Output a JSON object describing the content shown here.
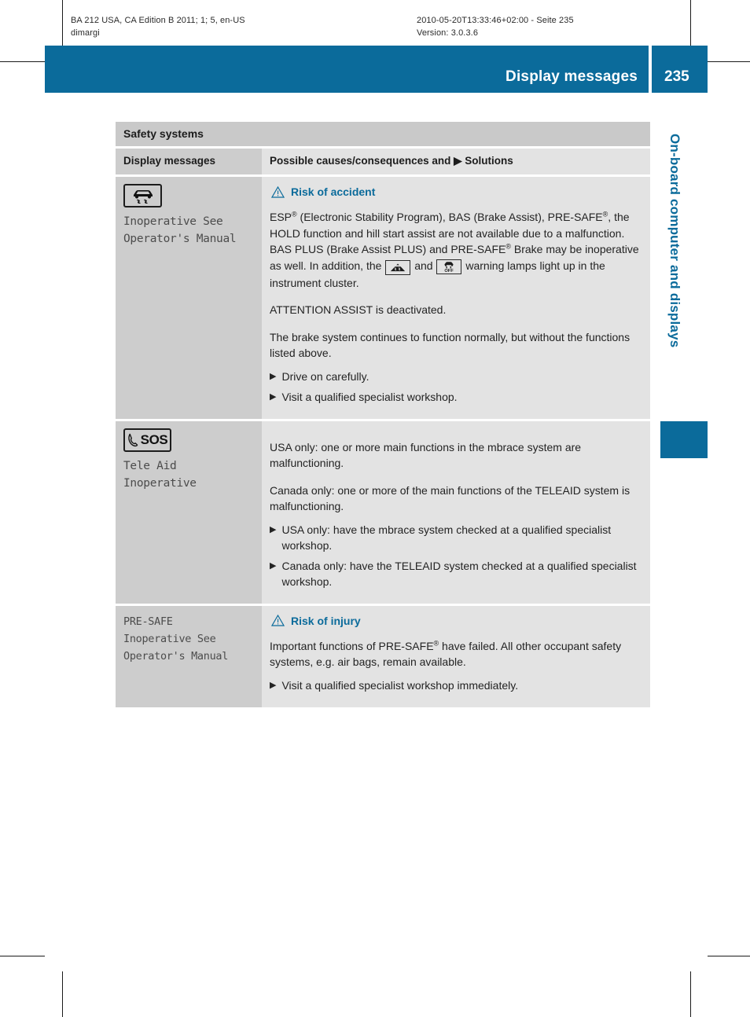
{
  "print_meta": {
    "left_line1": "BA 212 USA, CA Edition B 2011; 1; 5, en-US",
    "left_line2": "dimargi",
    "right_line1": "2010-05-20T13:33:46+02:00 - Seite 235",
    "right_line2": "Version: 3.0.3.6"
  },
  "header": {
    "title": "Display messages",
    "page_number": "235",
    "accent_color": "#0b6b9b"
  },
  "side_tab": {
    "label": "On-board computer and displays"
  },
  "table": {
    "section_title": "Safety systems",
    "columns": {
      "left": "Display messages",
      "right_before": "Possible causes/consequences and",
      "right_marker": "▶",
      "right_after": "Solutions"
    },
    "rows": [
      {
        "icon": "esp-warning-icon",
        "message_lines": "Inoperative See\nOperator's Manual",
        "warning": {
          "title": "Risk of accident",
          "icon": "warning-triangle-icon"
        },
        "paragraphs": [
          {
            "segments": [
              {
                "t": "ESP"
              },
              {
                "sup": "®"
              },
              {
                "t": " (Electronic Stability Program), BAS (Brake Assist), PRE-SAFE"
              },
              {
                "sup": "®"
              },
              {
                "t": ", the HOLD function and hill start assist are not available due to a malfunction. BAS PLUS (Brake Assist PLUS) and PRE-SAFE"
              },
              {
                "sup": "®"
              },
              {
                "t": " Brake may be inoperative as well. In addition, the "
              },
              {
                "lamp": "esp-lamp-icon"
              },
              {
                "t": " and "
              },
              {
                "lamp": "esp-off-lamp-icon"
              },
              {
                "t": " warning lamps light up in the instrument cluster."
              }
            ]
          },
          {
            "segments": [
              {
                "t": "ATTENTION ASSIST is deactivated."
              }
            ]
          },
          {
            "segments": [
              {
                "t": "The brake system continues to function normally, but without the functions listed above."
              }
            ]
          }
        ],
        "bullets": [
          "Drive on carefully.",
          "Visit a qualified specialist workshop."
        ]
      },
      {
        "icon": "sos-tele-aid-icon",
        "icon_text": "SOS",
        "message_lines": "Tele Aid\nInoperative",
        "warning": null,
        "paragraphs": [
          {
            "segments": [
              {
                "t": "USA only: one or more main functions in the mbrace system are malfunctioning."
              }
            ]
          },
          {
            "segments": [
              {
                "t": "Canada only: one or more of the main functions of the TELEAID system is malfunctioning."
              }
            ]
          }
        ],
        "bullets": [
          "USA only: have the mbrace system checked at a qualified specialist workshop.",
          "Canada only: have the TELEAID system checked at a qualified specialist workshop."
        ]
      },
      {
        "icon": null,
        "message_lines": "PRE-SAFE\nInoperative See\nOperator's Manual",
        "warning": {
          "title": "Risk of injury",
          "icon": "warning-triangle-icon"
        },
        "paragraphs": [
          {
            "segments": [
              {
                "t": "Important functions of PRE-SAFE"
              },
              {
                "sup": "®"
              },
              {
                "t": " have failed. All other occupant safety systems, e.g. air bags, remain available."
              }
            ]
          }
        ],
        "bullets": [
          "Visit a qualified specialist workshop immediately."
        ]
      }
    ]
  }
}
